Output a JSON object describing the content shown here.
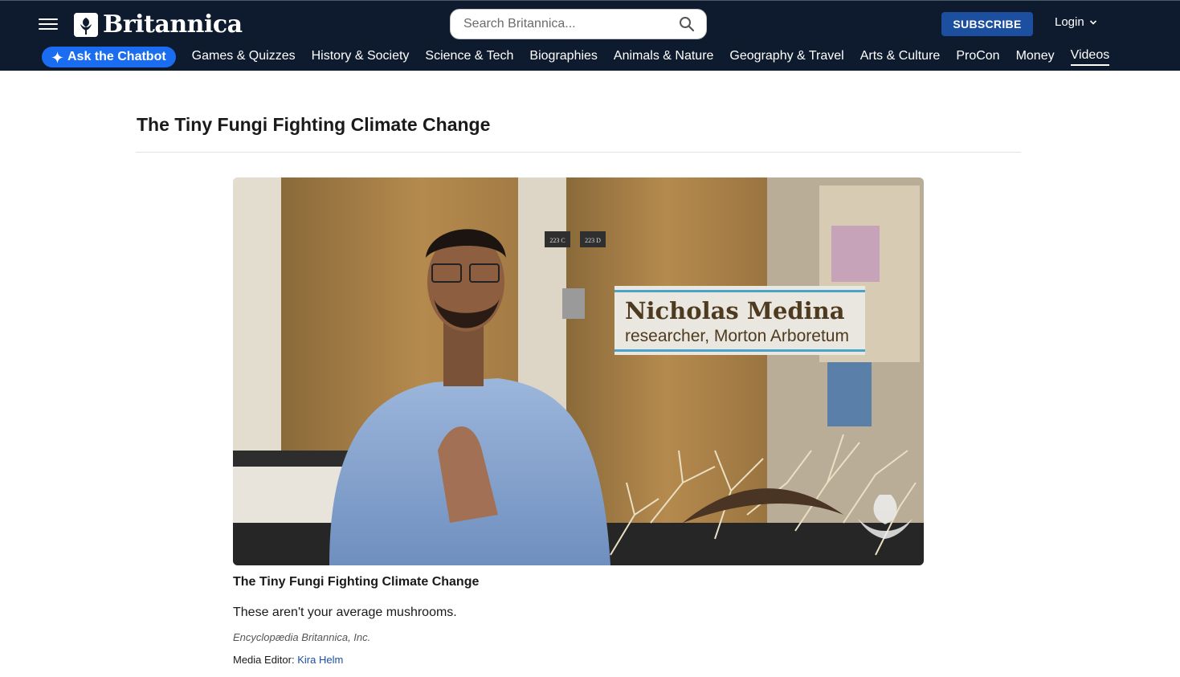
{
  "header": {
    "logo_text": "Britannica",
    "search_placeholder": "Search Britannica...",
    "subscribe_label": "SUBSCRIBE",
    "login_label": "Login",
    "colors": {
      "background": "#0e1b2e",
      "subscribe": "#1c4fa0",
      "chatbot": "#1a6cf0"
    }
  },
  "nav": {
    "chatbot_label": "Ask the Chatbot",
    "items": [
      {
        "label": "Games & Quizzes"
      },
      {
        "label": "History & Society"
      },
      {
        "label": "Science & Tech"
      },
      {
        "label": "Biographies"
      },
      {
        "label": "Animals & Nature"
      },
      {
        "label": "Geography & Travel"
      },
      {
        "label": "Arts & Culture"
      },
      {
        "label": "ProCon"
      },
      {
        "label": "Money"
      },
      {
        "label": "Videos",
        "active": true
      }
    ]
  },
  "main": {
    "title": "The Tiny Fungi Fighting Climate Change",
    "video": {
      "lower_third_name": "Nicholas Medina",
      "lower_third_role": "researcher, Morton Arboretum",
      "door_sign_1": "223 C",
      "door_sign_2": "223 D"
    },
    "caption": {
      "title": "The Tiny Fungi Fighting Climate Change",
      "description": "These aren't your average mushrooms.",
      "credit": "Encyclopædia Britannica, Inc.",
      "editor_label": "Media Editor:",
      "editor_name": "Kira Helm"
    }
  }
}
